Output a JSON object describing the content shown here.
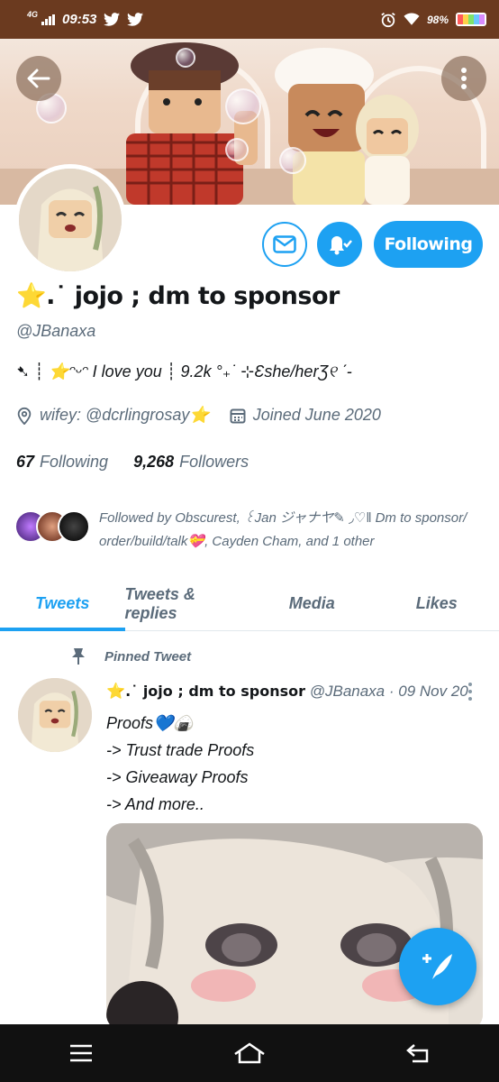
{
  "status_bar": {
    "network": "4G",
    "time": "09:53",
    "battery_percent": "98%",
    "battery_level": 0.98,
    "icons": [
      "signal-icon",
      "twitter-icon",
      "twitter-icon",
      "alarm-icon",
      "wifi-icon",
      "battery-icon"
    ]
  },
  "header": {
    "back_icon": "arrow-left-icon",
    "more_icon": "vertical-dots-icon"
  },
  "profile": {
    "display_name_emoji": "⭐",
    "display_name_text": ".˙ jojo ; dm to sponsor",
    "handle": "@JBanaxa",
    "bio_prefix": "➷ ┊",
    "bio_emoji": "⭐",
    "bio_text": "ᵔᵕᵔ I love you ┊ 9.2k °₊˙ ⊹Ɛshe/herƷ୧ ˊ-",
    "location": "wifey: @dcrlingrosay",
    "location_emoji": "⭐",
    "joined": "Joined June 2020",
    "following_count": "67",
    "following_label": "Following",
    "followers_count": "9,268",
    "followers_label": "Followers",
    "followed_by_line1": "Followed by Obscurest, ꒰Jan ジャナヤ✎ ◞♡‖ Dm to sponsor/",
    "followed_by_line2": "order/build/talk💝, Cayden Cham, and 1 other"
  },
  "actions": {
    "message_icon": "envelope-icon",
    "notify_icon": "bell-check-icon",
    "follow_label": "Following"
  },
  "tabs": [
    {
      "label": "Tweets",
      "active": true
    },
    {
      "label": "Tweets & replies",
      "active": false
    },
    {
      "label": "Media",
      "active": false
    },
    {
      "label": "Likes",
      "active": false
    }
  ],
  "tweet": {
    "pinned_label": "Pinned Tweet",
    "author_emoji": "⭐",
    "author": ".˙ jojo ; dm to sponsor",
    "meta": "@JBanaxa · 09 Nov 20",
    "lines": [
      "Proofs💙🍙",
      "-> Trust trade Proofs",
      "-> Giveaway Proofs",
      "-> And more.."
    ]
  },
  "fab": {
    "icon": "compose-tweet-icon"
  },
  "colors": {
    "accent": "#1da1f2",
    "status_bar": "#6b3a1f",
    "secondary_text": "#5b6b7a"
  }
}
